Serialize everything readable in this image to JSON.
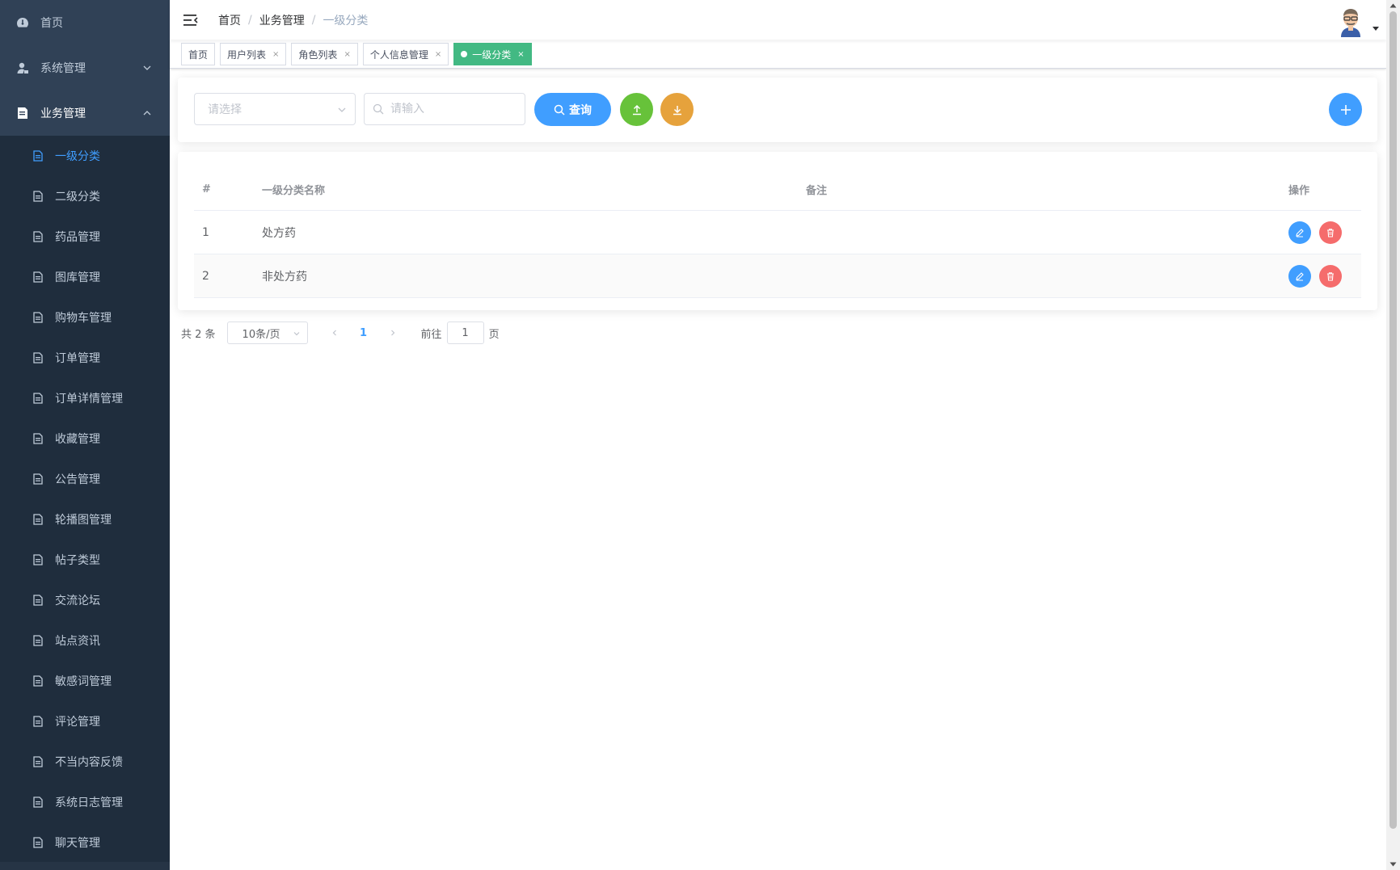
{
  "sidebar": {
    "top_items": [
      {
        "label": "首页",
        "icon": "dashboard-icon"
      },
      {
        "label": "系统管理",
        "icon": "user-icon"
      },
      {
        "label": "业务管理",
        "icon": "document-icon"
      }
    ],
    "sub_items": [
      {
        "label": "一级分类",
        "active": true
      },
      {
        "label": "二级分类"
      },
      {
        "label": "药品管理"
      },
      {
        "label": "图库管理"
      },
      {
        "label": "购物车管理"
      },
      {
        "label": "订单管理"
      },
      {
        "label": "订单详情管理"
      },
      {
        "label": "收藏管理"
      },
      {
        "label": "公告管理"
      },
      {
        "label": "轮播图管理"
      },
      {
        "label": "帖子类型"
      },
      {
        "label": "交流论坛"
      },
      {
        "label": "站点资讯"
      },
      {
        "label": "敏感词管理"
      },
      {
        "label": "评论管理"
      },
      {
        "label": "不当内容反馈"
      },
      {
        "label": "系统日志管理"
      },
      {
        "label": "聊天管理"
      }
    ]
  },
  "navbar": {
    "breadcrumb": [
      "首页",
      "业务管理",
      "一级分类"
    ],
    "separator": "/"
  },
  "tags": [
    {
      "label": "首页",
      "closable": false
    },
    {
      "label": "用户列表",
      "closable": true
    },
    {
      "label": "角色列表",
      "closable": true
    },
    {
      "label": "个人信息管理",
      "closable": true
    },
    {
      "label": "一级分类",
      "closable": true,
      "active": true
    }
  ],
  "tag_close": "×",
  "search": {
    "select_placeholder": "请选择",
    "input_placeholder": "请输入",
    "query_label": "查询"
  },
  "table": {
    "headers": {
      "index": "#",
      "name": "一级分类名称",
      "remark": "备注",
      "ops": "操作"
    },
    "rows": [
      {
        "index": "1",
        "name": "处方药",
        "remark": ""
      },
      {
        "index": "2",
        "name": "非处方药",
        "remark": ""
      }
    ]
  },
  "pagination": {
    "total": "共 2 条",
    "page_size": "10条/页",
    "current_page": "1",
    "goto_prefix": "前往",
    "goto_value": "1",
    "goto_suffix": "页"
  },
  "colors": {
    "sidebar_bg": "#304156",
    "submenu_bg": "#1f2d3d",
    "primary": "#409eff",
    "success": "#67c23a",
    "warning": "#e6a23c",
    "danger": "#f56c6c",
    "active_tag": "#42b983"
  }
}
